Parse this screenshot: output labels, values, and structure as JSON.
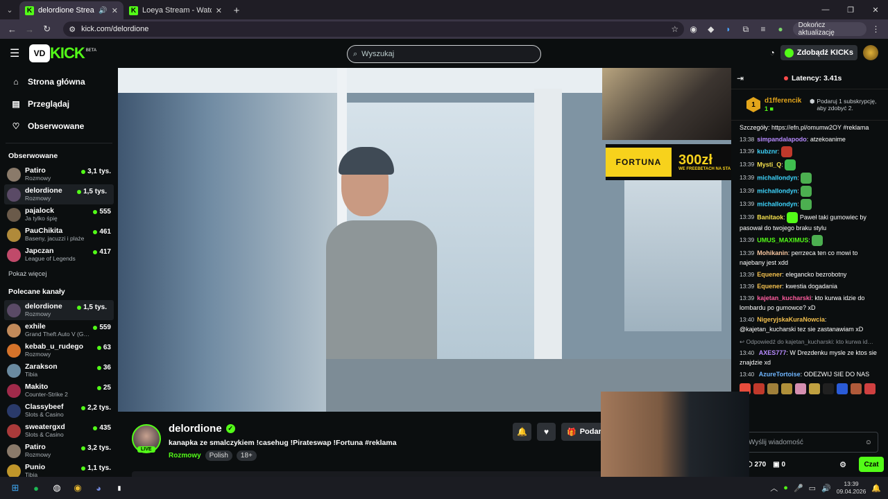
{
  "browser": {
    "tabs": [
      {
        "title": "delordione Stream - Watch",
        "active": true
      },
      {
        "title": "Loeya Stream - Watch Live on K",
        "active": false
      }
    ],
    "url": "kick.com/delordione",
    "update_label": "Dokończ aktualizację"
  },
  "header": {
    "logo_box": "VD",
    "logo_text": "KICK",
    "logo_beta": "BETA",
    "search_placeholder": "Wyszukaj",
    "kicks_button": "Zdobądź KICKs"
  },
  "sidebar": {
    "nav": [
      {
        "label": "Strona główna",
        "icon": "home-icon"
      },
      {
        "label": "Przeglądaj",
        "icon": "browse-icon"
      },
      {
        "label": "Obserwowane",
        "icon": "heart-icon"
      }
    ],
    "followed_title": "Obserwowane",
    "followed": [
      {
        "name": "Patiro",
        "category": "Rozmowy",
        "viewers": "3,1 tys.",
        "color": "#8a7a6a",
        "selected": false
      },
      {
        "name": "delordione",
        "category": "Rozmowy",
        "viewers": "1,5 tys.",
        "color": "#5a4a66",
        "selected": true
      },
      {
        "name": "pajalock",
        "category": "Ja tylko śpię",
        "viewers": "555",
        "color": "#6a5a4a",
        "selected": false
      },
      {
        "name": "PauChikita",
        "category": "Baseny, jacuzzi i plaże",
        "viewers": "461",
        "color": "#b08a3a",
        "selected": false
      },
      {
        "name": "Japczan",
        "category": "League of Legends",
        "viewers": "417",
        "color": "#c04a6a",
        "selected": false
      }
    ],
    "show_more": "Pokaż więcej",
    "recommended_title": "Polecane kanały",
    "recommended": [
      {
        "name": "delordione",
        "category": "Rozmowy",
        "viewers": "1,5 tys.",
        "color": "#5a4a66",
        "selected": true
      },
      {
        "name": "exhile",
        "category": "Grand Theft Auto V (G…",
        "viewers": "559",
        "color": "#c28a5a",
        "selected": false
      },
      {
        "name": "kebab_u_rudego",
        "category": "Rozmowy",
        "viewers": "63",
        "color": "#d5732a",
        "selected": false
      },
      {
        "name": "Zarakson",
        "category": "Tibia",
        "viewers": "36",
        "color": "#6a8aa0",
        "selected": false
      },
      {
        "name": "Makito",
        "category": "Counter-Strike 2",
        "viewers": "25",
        "color": "#a02a4a",
        "selected": false
      },
      {
        "name": "Classybeef",
        "category": "Slots & Casino",
        "viewers": "2,2 tys.",
        "color": "#2a3a6a",
        "selected": false
      },
      {
        "name": "sweatergxd",
        "category": "Slots & Casino",
        "viewers": "435",
        "color": "#aa3a3a",
        "selected": false
      },
      {
        "name": "Patiro",
        "category": "Rozmowy",
        "viewers": "3,2 tys.",
        "color": "#8a7a6a",
        "selected": false
      },
      {
        "name": "Punio",
        "category": "Tibia",
        "viewers": "1,1 tys.",
        "color": "#c0962a",
        "selected": false
      }
    ]
  },
  "video": {
    "fortuna_label": "FORTUNA",
    "fortuna_amount": "300zł",
    "fortuna_sub": "WE FREEBETACH NA STA"
  },
  "stream": {
    "name": "delordione",
    "live": "LIVE",
    "title": "kanapka ze smalczykiem !casehug !Pirateswap !Fortuna #reklama",
    "category": "Rozmowy",
    "tags": [
      "Polish",
      "18+"
    ],
    "gift_label": "Podaruj"
  },
  "chat": {
    "latency": "Latency: 3.41s",
    "pinned_user": "d1fferencik",
    "pinned_rank": "1",
    "pinned_count": "1",
    "pinned_note": "Podaruj 1 subskrypcję, aby zdobyć 2.",
    "messages": [
      {
        "time": "",
        "user": "",
        "color": "#ffffff",
        "text": "Szczegóły: https://efn.pl/omumw2OY #reklama",
        "emote": ""
      },
      {
        "time": "13:38",
        "user": "simpandalapodo",
        "color": "#b78bff",
        "text": "atzekoanime",
        "emote": ""
      },
      {
        "time": "13:39",
        "user": "kubznr",
        "color": "#3ed6ff",
        "text": "",
        "emote": "#c0392b"
      },
      {
        "time": "13:39",
        "user": "Mysti_Q",
        "color": "#f4e04d",
        "text": "",
        "emote": "#3fbf4f"
      },
      {
        "time": "13:39",
        "user": "michallondyn",
        "color": "#3ed6ff",
        "text": "",
        "emote": "#4caf50"
      },
      {
        "time": "13:39",
        "user": "michallondyn",
        "color": "#3ed6ff",
        "text": "",
        "emote": "#4caf50"
      },
      {
        "time": "13:39",
        "user": "michallondyn",
        "color": "#3ed6ff",
        "text": "",
        "emote": "#4caf50"
      },
      {
        "time": "13:39",
        "user": "Banitaok",
        "color": "#f4e04d",
        "text": "Paweł taki gumowiec by pasował do twojego braku stylu",
        "emote": "#53fc18"
      },
      {
        "time": "13:39",
        "user": "UMUS_MAXIMUS",
        "color": "#53fc18",
        "text": "",
        "emote": "#4caf50"
      },
      {
        "time": "13:39",
        "user": "Mohikanin",
        "color": "#f7c59f",
        "text": "perrzeca ten co mowi to najebany jest xdd",
        "emote": ""
      },
      {
        "time": "13:39",
        "user": "Equener",
        "color": "#f4c04d",
        "text": "elegancko bezrobotny",
        "emote": ""
      },
      {
        "time": "13:39",
        "user": "Equener",
        "color": "#f4c04d",
        "text": "kwestia dogadania",
        "emote": ""
      },
      {
        "time": "13:39",
        "user": "kajetan_kucharski",
        "color": "#ff5c9e",
        "text": "kto kurwa idzie do lombardu po gumowce? xD",
        "emote": ""
      },
      {
        "time": "13:40",
        "user": "NigeryjskaKuraNowcia",
        "color": "#f4c04d",
        "text": "@kajetan_kucharski tez sie zastanawiam xD",
        "emote": ""
      }
    ],
    "reply_preview": "Odpowiedź do kajetan_kucharski: kto kurwa id…",
    "msg_after_reply": {
      "time": "13:40",
      "user": "AXES777",
      "color": "#b78bff",
      "text": "W Drezdenku mysle ze ktos sie znajdzie xd"
    },
    "last_msg": {
      "time": "13:40",
      "user": "AzureTortoise",
      "color": "#6fb6ff",
      "text": "ODEZWIJ SIE DO NAS"
    },
    "input_placeholder": "Wyślij wiadomość",
    "points": "270",
    "bag_count": "0",
    "chat_button": "Czat"
  },
  "taskbar": {
    "time": "13:39",
    "date": "09.04.2026"
  }
}
